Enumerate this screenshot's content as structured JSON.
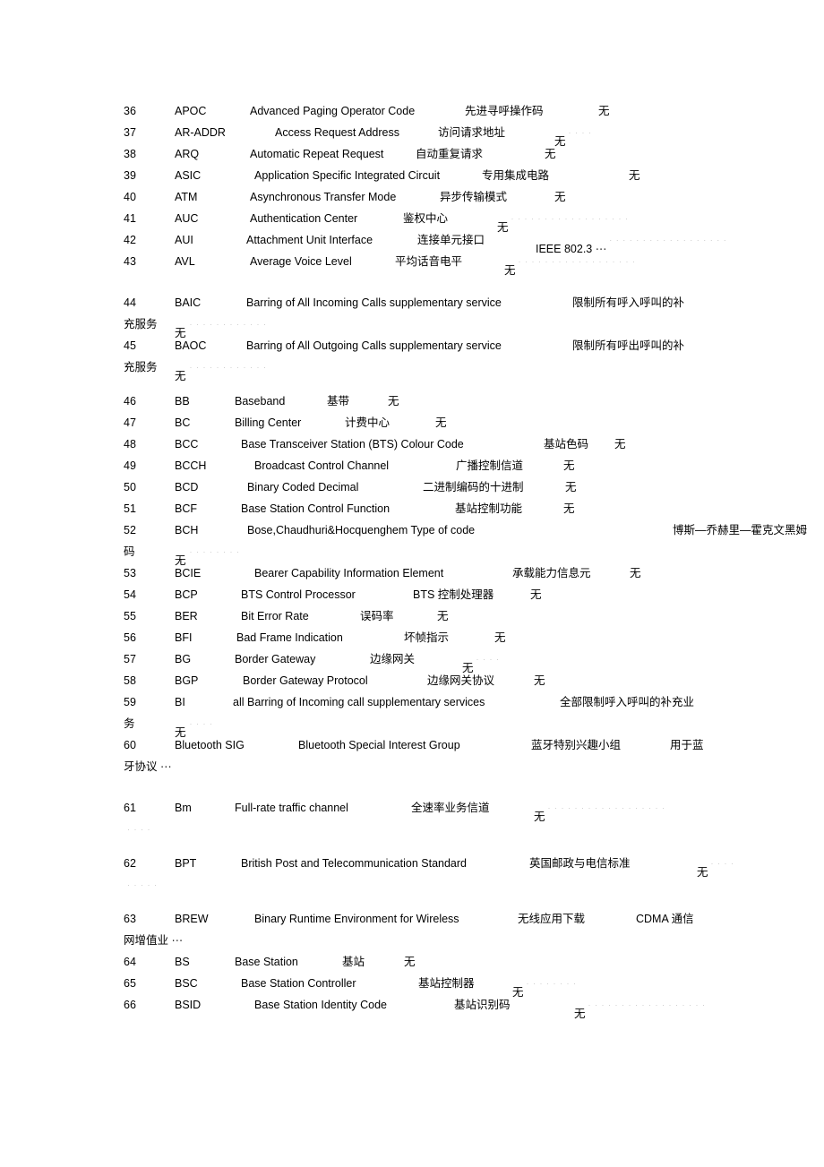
{
  "document": {
    "type": "glossary-table",
    "description": "Telecom abbreviations glossary page, entries 36-66",
    "columns": [
      "index",
      "abbreviation",
      "english_full_name",
      "chinese_translation",
      "remarks"
    ]
  },
  "rows": [
    {
      "num": "36",
      "abbr": "APOC",
      "eng": "Advanced Paging Operator Code",
      "cn": "先进寻呼操作码",
      "note": "无",
      "x": {
        "eng": 141,
        "cn": 381,
        "note": 530
      },
      "trail": ""
    },
    {
      "num": "37",
      "abbr": "AR-ADDR",
      "eng": "Access Request Address",
      "cn": "访问请求地址",
      "note": "无",
      "x": {
        "eng": 169,
        "cn": 351,
        "note": 481
      },
      "trail": "t4"
    },
    {
      "num": "38",
      "abbr": "ARQ",
      "eng": "Automatic Repeat Request",
      "cn": "自动重复请求",
      "note": "无",
      "x": {
        "eng": 141,
        "cn": 326,
        "note": 470
      },
      "trail": ""
    },
    {
      "num": "39",
      "abbr": "ASIC",
      "eng": "Application Specific Integrated Circuit",
      "cn": "专用集成电路",
      "note": "无",
      "x": {
        "eng": 146,
        "cn": 400,
        "note": 564
      },
      "trail": ""
    },
    {
      "num": "40",
      "abbr": "ATM",
      "eng": "Asynchronous Transfer Mode",
      "cn": "异步传输模式",
      "note": "无",
      "x": {
        "eng": 141,
        "cn": 353,
        "note": 481
      },
      "trail": ""
    },
    {
      "num": "41",
      "abbr": "AUC",
      "eng": "Authentication Center",
      "cn": "鉴权中心",
      "note": "无",
      "x": {
        "eng": 141,
        "cn": 312,
        "note": 417
      },
      "trail": "t3"
    },
    {
      "num": "42",
      "abbr": "AUI",
      "eng": "Attachment Unit Interface",
      "cn": "连接单元接口",
      "note": "IEEE 802.3",
      "x": {
        "eng": 137,
        "cn": 328,
        "note": 460
      },
      "trail": "t5",
      "ellipsis": true
    },
    {
      "num": "43",
      "abbr": "AVL",
      "eng": "Average Voice Level",
      "cn": "平均话音电平",
      "note": "无",
      "x": {
        "eng": 141,
        "cn": 303,
        "note": 425
      },
      "trail": "t3"
    },
    {
      "num": "44",
      "abbr": "BAIC",
      "eng": "Barring of All Incoming Calls supplementary service",
      "cn": "限制所有呼入呼叫的补",
      "note": "",
      "x": {
        "eng": 137,
        "cn": 501,
        "note": 0
      },
      "gap": "gap-before",
      "wrap": {
        "cn2": "充服务",
        "note": "无",
        "x": {
          "cn2": 0,
          "note": 57
        },
        "trail": "t2"
      }
    },
    {
      "num": "45",
      "abbr": "BAOC",
      "eng": "Barring of All Outgoing Calls supplementary service",
      "cn": "限制所有呼出呼叫的补",
      "note": "",
      "x": {
        "eng": 137,
        "cn": 501,
        "note": 0
      },
      "wrap": {
        "cn2": "充服务",
        "note": "无",
        "x": {
          "cn2": 0,
          "note": 57
        },
        "trail": "t2"
      }
    },
    {
      "num": "46",
      "abbr": "BB",
      "eng": "Baseband",
      "cn": "基带",
      "note": "无",
      "x": {
        "eng": 124,
        "cn": 227,
        "note": 295
      },
      "gap": "gap-small"
    },
    {
      "num": "47",
      "abbr": "BC",
      "eng": "Billing Center",
      "cn": "计费中心",
      "note": "无",
      "x": {
        "eng": 124,
        "cn": 247,
        "note": 348
      }
    },
    {
      "num": "48",
      "abbr": "BCC",
      "eng": "Base Transceiver Station (BTS) Colour Code",
      "cn": "基站色码",
      "note": "无",
      "x": {
        "eng": 131,
        "cn": 469,
        "note": 548
      }
    },
    {
      "num": "49",
      "abbr": "BCCH",
      "eng": "Broadcast Control Channel",
      "cn": "广播控制信道",
      "note": "无",
      "x": {
        "eng": 146,
        "cn": 371,
        "note": 491
      }
    },
    {
      "num": "50",
      "abbr": "BCD",
      "eng": "Binary Coded Decimal",
      "cn": "二进制编码的十进制",
      "note": "无",
      "x": {
        "eng": 138,
        "cn": 334,
        "note": 493
      }
    },
    {
      "num": "51",
      "abbr": "BCF",
      "eng": "Base Station Control Function",
      "cn": "基站控制功能",
      "note": "无",
      "x": {
        "eng": 131,
        "cn": 370,
        "note": 491
      }
    },
    {
      "num": "52",
      "abbr": "BCH",
      "eng": "Bose,Chaudhuri&Hocquenghem    Type  of  code",
      "cn": "博斯—乔赫里—霍克文黑姆",
      "note": "",
      "x": {
        "eng": 138,
        "cn": 613,
        "note": 0
      },
      "wrap": {
        "cn2": "码",
        "note": "无",
        "x": {
          "cn2": 0,
          "note": 57
        },
        "trail": "t1"
      }
    },
    {
      "num": "53",
      "abbr": "BCIE",
      "eng": "Bearer Capability Information Element",
      "cn": "承载能力信息元",
      "note": "无",
      "x": {
        "eng": 146,
        "cn": 434,
        "note": 565
      }
    },
    {
      "num": "54",
      "abbr": "BCP",
      "eng": "BTS Control Processor",
      "cn": "BTS 控制处理器",
      "note": "无",
      "x": {
        "eng": 131,
        "cn": 323,
        "note": 454
      }
    },
    {
      "num": "55",
      "abbr": "BER",
      "eng": "Bit Error Rate",
      "cn": "误码率",
      "note": "无",
      "x": {
        "eng": 131,
        "cn": 264,
        "note": 350
      }
    },
    {
      "num": "56",
      "abbr": "BFI",
      "eng": "Bad Frame Indication",
      "cn": "坏帧指示",
      "note": "无",
      "x": {
        "eng": 126,
        "cn": 313,
        "note": 414
      }
    },
    {
      "num": "57",
      "abbr": "BG",
      "eng": "Border Gateway",
      "cn": "边缘网关",
      "note": "无",
      "x": {
        "eng": 124,
        "cn": 275,
        "note": 378
      },
      "trail": "t4"
    },
    {
      "num": "58",
      "abbr": "BGP",
      "eng": "Border Gateway Protocol",
      "cn": "边缘网关协议",
      "note": "无",
      "x": {
        "eng": 133,
        "cn": 339,
        "note": 458
      }
    },
    {
      "num": "59",
      "abbr": "BI",
      "eng": "all Barring of Incoming call supplementary services",
      "cn": "全部限制呼入呼叫的补充业",
      "note": "",
      "x": {
        "eng": 122,
        "cn": 487,
        "note": 0
      },
      "wrap": {
        "cn2": "务",
        "note": "无",
        "x": {
          "cn2": 0,
          "note": 57
        },
        "trail": "t4"
      }
    },
    {
      "num": "60",
      "abbr": "Bluetooth  SIG",
      "eng": "Bluetooth  Special  Interest  Group",
      "cn": "蓝牙特别兴趣小组",
      "note": "用于蓝",
      "x": {
        "eng": 195,
        "cn": 455,
        "note": 610
      },
      "wrap": {
        "cn2": "牙协议",
        "note": "",
        "x": {
          "cn2": 0,
          "note": 0
        },
        "trail": "t4",
        "ellipsis": true
      }
    },
    {
      "num": "61",
      "abbr": "Bm",
      "eng": "Full-rate traffic channel",
      "cn": "全速率业务信道",
      "note": "无",
      "x": {
        "eng": 124,
        "cn": 321,
        "note": 458
      },
      "gap": "gap-before",
      "trail": "t3",
      "wrap": {
        "cn2": "",
        "note": "",
        "x": {
          "cn2": 0,
          "note": 0
        },
        "trail": "t4"
      }
    },
    {
      "num": "62",
      "abbr": "BPT",
      "eng": "British Post and Telecommunication Standard",
      "cn": "英国邮政与电信标准",
      "note": "无",
      "x": {
        "eng": 131,
        "cn": 453,
        "note": 640
      },
      "gap": "gap-small",
      "trail": "t4",
      "wrap": {
        "cn2": "",
        "note": "",
        "x": {
          "cn2": 0,
          "note": 0
        },
        "trail": "t1"
      }
    },
    {
      "num": "63",
      "abbr": "BREW",
      "eng": "Binary Runtime Environment for Wireless",
      "cn": "无线应用下载",
      "note": "CDMA 通信",
      "x": {
        "eng": 146,
        "cn": 440,
        "note": 572
      },
      "gap": "gap-small",
      "wrap": {
        "cn2": "网增值业",
        "note": "",
        "x": {
          "cn2": 0,
          "note": 0
        },
        "ellipsis": true
      }
    },
    {
      "num": "64",
      "abbr": "BS",
      "eng": "Base Station",
      "cn": "基站",
      "note": "无",
      "x": {
        "eng": 124,
        "cn": 244,
        "note": 313
      }
    },
    {
      "num": "65",
      "abbr": "BSC",
      "eng": "Base Station Controller",
      "cn": "基站控制器",
      "note": "无",
      "x": {
        "eng": 131,
        "cn": 329,
        "note": 434
      },
      "trail": "t1"
    },
    {
      "num": "66",
      "abbr": "BSID",
      "eng": "Base  Station  Identity  Code",
      "cn": "基站识别码",
      "note": "无",
      "x": {
        "eng": 146,
        "cn": 369,
        "note": 503
      },
      "trail": "t5"
    }
  ]
}
